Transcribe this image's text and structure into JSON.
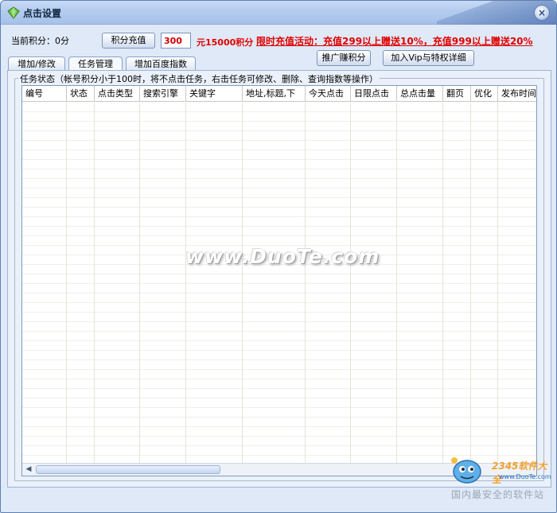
{
  "window": {
    "title": "点击设置",
    "close_label": "×"
  },
  "account": {
    "points_label": "当前积分：",
    "points_value": "0分",
    "recharge_button": "积分充值",
    "amount_value": "300",
    "amount_result": "元15000积分",
    "promo_text": "限时充值活动：充值299以上赠送10%，充值999以上赠送20%"
  },
  "actions": {
    "promote_button": "推广赚积分",
    "vip_button": "加入Vip与特权详细"
  },
  "tabs": [
    {
      "label": "增加/修改"
    },
    {
      "label": "任务管理"
    },
    {
      "label": "增加百度指数"
    }
  ],
  "task_group": {
    "legend": "任务状态（帐号积分小于100时，将不点击任务，右击任务可修改、删除、查询指数等操作）"
  },
  "table": {
    "columns": [
      "编号",
      "状态",
      "点击类型",
      "搜索引擎",
      "关键字",
      "地址,标题,下",
      "今天点击",
      "日限点击",
      "总点击量",
      "翻页",
      "优化",
      "发布时间"
    ]
  },
  "watermark": "www.DuoTe.com",
  "branding": {
    "logo_text": "2345软件大全",
    "logo_url": "www.DuoTe.com",
    "slogan": "国内最安全的软件站"
  },
  "colors": {
    "accent_red": "#e00000",
    "frame_blue": "#5b7fb5",
    "panel_bg": "#dfe9f7"
  }
}
